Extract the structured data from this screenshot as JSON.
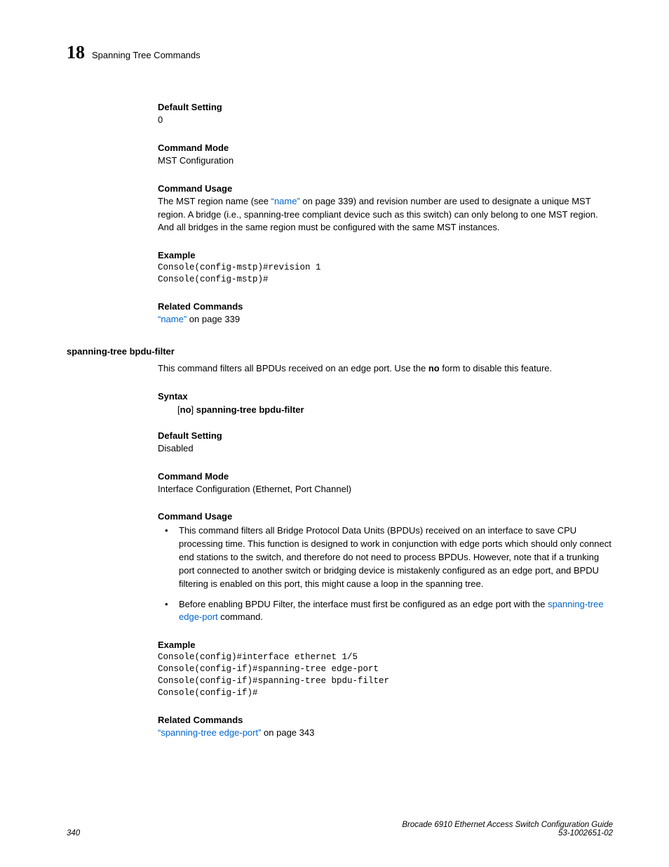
{
  "header": {
    "chapter_number": "18",
    "chapter_title": "Spanning Tree Commands"
  },
  "sections": {
    "default_setting_1": {
      "heading": "Default Setting",
      "value": "0"
    },
    "command_mode_1": {
      "heading": "Command Mode",
      "value": "MST Configuration"
    },
    "command_usage_1": {
      "heading": "Command Usage",
      "pre_link": "The MST region name (see ",
      "link": "“name”",
      "post_link": " on page 339) and revision number are used to designate a unique MST region. A bridge (i.e., spanning-tree compliant device such as this switch) can only belong to one MST region. And all bridges in the same region must be configured with the same MST instances."
    },
    "example_1": {
      "heading": "Example",
      "code": "Console(config-mstp)#revision 1\nConsole(config-mstp)#"
    },
    "related_1": {
      "heading": "Related Commands",
      "link": "“name”",
      "rest": " on page 339"
    },
    "cmd2_title": "spanning-tree bpdu-filter",
    "cmd2_desc_pre": "This command filters all BPDUs received on an edge port. Use the ",
    "cmd2_desc_bold": "no",
    "cmd2_desc_post": " form to disable this feature.",
    "syntax": {
      "heading": "Syntax",
      "bracket_open": "[",
      "no": "no",
      "bracket_close": "] ",
      "rest": "spanning-tree bpdu-filter"
    },
    "default_setting_2": {
      "heading": "Default Setting",
      "value": "Disabled"
    },
    "command_mode_2": {
      "heading": "Command Mode",
      "value": "Interface Configuration (Ethernet, Port Channel)"
    },
    "command_usage_2": {
      "heading": "Command Usage",
      "bullet1": "This command filters all Bridge Protocol Data Units (BPDUs) received on an interface to save CPU processing time. This function is designed to work in conjunction with edge ports which should only connect end stations to the switch, and therefore do not need to process BPDUs. However, note that if a trunking port connected to another switch or bridging device is mistakenly configured as an edge port, and BPDU filtering is enabled on this port, this might cause a loop in the spanning tree.",
      "bullet2_pre": "Before enabling BPDU Filter, the interface must first be configured as an edge port with the ",
      "bullet2_link": "spanning-tree edge-port",
      "bullet2_post": " command."
    },
    "example_2": {
      "heading": "Example",
      "code": "Console(config)#interface ethernet 1/5\nConsole(config-if)#spanning-tree edge-port\nConsole(config-if)#spanning-tree bpdu-filter\nConsole(config-if)#"
    },
    "related_2": {
      "heading": "Related Commands",
      "link": "“spanning-tree edge-port”",
      "rest": " on page 343"
    }
  },
  "footer": {
    "page_number": "340",
    "doc_title": "Brocade 6910 Ethernet Access Switch Configuration Guide",
    "doc_id": "53-1002651-02"
  }
}
